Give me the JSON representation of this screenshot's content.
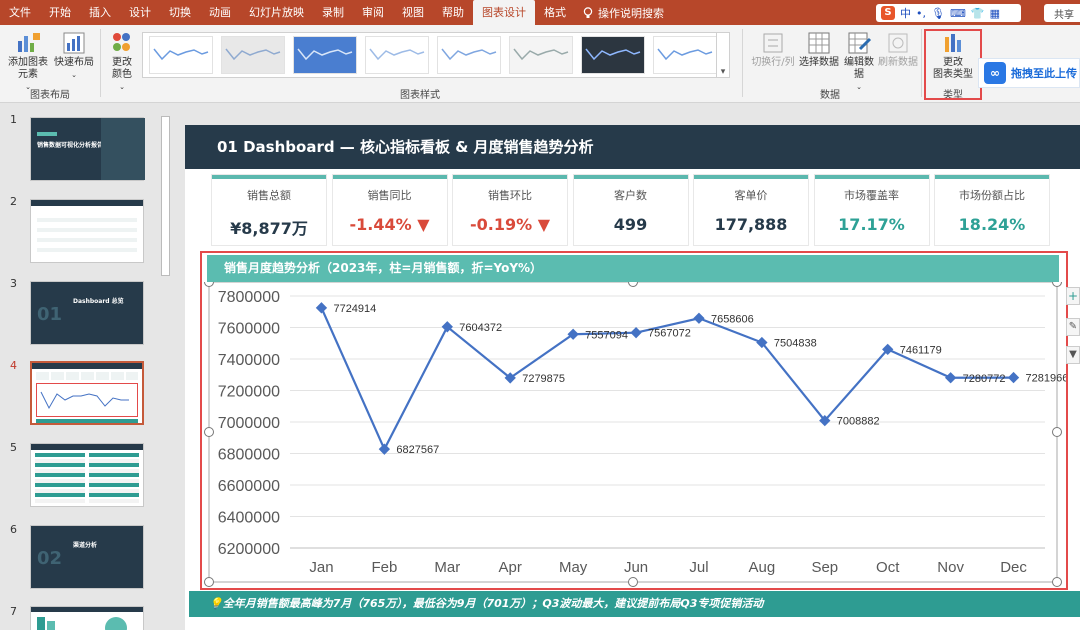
{
  "menu": {
    "items": [
      "文件",
      "开始",
      "插入",
      "设计",
      "切换",
      "动画",
      "幻灯片放映",
      "录制",
      "审阅",
      "视图",
      "帮助",
      "图表设计",
      "格式"
    ],
    "active": "图表设计",
    "tell_me": "操作说明搜索",
    "ime_label": "中",
    "share": "共享"
  },
  "ribbon": {
    "add_element": "添加图表\n元素",
    "quick_layout": "快速布局",
    "change_colors": "更改\n颜色",
    "group_layout": "图表布局",
    "group_styles": "图表样式",
    "switch_row_col": "切换行/列",
    "select_data": "选择数据",
    "edit_data": "编辑数\n据",
    "refresh_data": "刷新数据",
    "group_data": "数据",
    "change_type": "更改\n图表类型",
    "group_type": "类型",
    "baidu_upload": "拖拽至此上传"
  },
  "thumbnails": {
    "numbers": [
      "1",
      "2",
      "3",
      "4",
      "5",
      "6",
      "7"
    ],
    "selected": "4",
    "slide1_title": "销售数据可视化分析报告",
    "slide3_big": "01",
    "slide3_title": "Dashboard 总览",
    "slide6_big": "02",
    "slide6_title": "渠道分析"
  },
  "slide": {
    "header": "01  Dashboard — 核心指标看板 & 月度销售趋势分析",
    "kpis": [
      {
        "label": "销售总额",
        "value": "¥8,877万",
        "tone": "neutral"
      },
      {
        "label": "销售同比",
        "value": "-1.44% ▼",
        "tone": "neg"
      },
      {
        "label": "销售环比",
        "value": "-0.19% ▼",
        "tone": "neg"
      },
      {
        "label": "客户数",
        "value": "499",
        "tone": "neutral"
      },
      {
        "label": "客单价",
        "value": "177,888",
        "tone": "neutral"
      },
      {
        "label": "市场覆盖率",
        "value": "17.17%",
        "tone": "pos"
      },
      {
        "label": "市场份额占比",
        "value": "18.24%",
        "tone": "pos"
      }
    ],
    "chart_title": "销售月度趋势分析（2023年，柱=月销售额，折=YoY%）",
    "footer": "💡全年月销售额最高峰为7月（765万），最低谷为9月（701万）；Q3波动最大，建议提前布局Q3专项促销活动"
  },
  "colors": {
    "menu_bar": "#b7472a",
    "header_dark": "#263a4a",
    "teal": "#5bbcb0",
    "teal_dark": "#2e9c92",
    "line": "#4472c4",
    "negative": "#d94a3a",
    "highlight": "#e34a4a"
  },
  "chart_data": {
    "type": "line",
    "categories": [
      "Jan",
      "Feb",
      "Mar",
      "Apr",
      "May",
      "Jun",
      "Jul",
      "Aug",
      "Sep",
      "Oct",
      "Nov",
      "Dec"
    ],
    "series": [
      {
        "values": [
          7724914,
          6827567,
          7604372,
          7279875,
          7557094,
          7567072,
          7658606,
          7504838,
          7008882,
          7461179,
          7280772,
          7281966
        ]
      }
    ],
    "data_labels": [
      "7724914",
      "6827567",
      "7604372",
      "7279875",
      "7557094",
      "7567072",
      "7658606",
      "7504838",
      "7008882",
      "7461179",
      "7280772",
      "7281966"
    ],
    "yticks": [
      "7800000",
      "7600000",
      "7400000",
      "7200000",
      "7000000",
      "6800000",
      "6600000",
      "6400000",
      "6200000"
    ],
    "ylim": [
      6200000,
      7800000
    ],
    "grid": true,
    "legend": "none"
  }
}
